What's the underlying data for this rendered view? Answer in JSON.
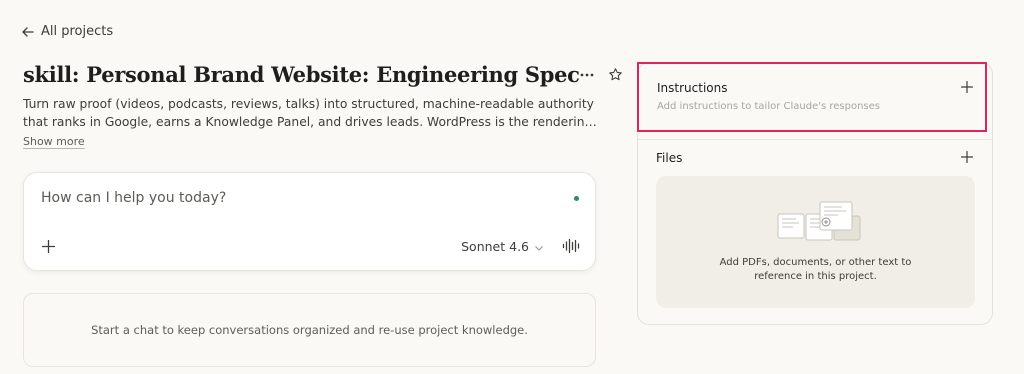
{
  "nav": {
    "back_label": "All projects"
  },
  "project": {
    "title": "skill: Personal Brand Website: Engineering Spec",
    "description": "Turn raw proof (videos, podcasts, reviews, talks) into structured, machine-readable authority that ranks in Google, earns a Knowledge Panel, and drives leads. WordPress is the rendering and editorial layer; th…",
    "show_more_label": "Show more"
  },
  "composer": {
    "placeholder": "How can I help you today?",
    "model": "Sonnet 4.6",
    "status_color": "#2a8a6c"
  },
  "chats": {
    "empty_text": "Start a chat to keep conversations organized and re-use project knowledge."
  },
  "instructions": {
    "title": "Instructions",
    "subtitle": "Add instructions to tailor Claude's responses",
    "highlight_color": "#e0245e"
  },
  "files": {
    "title": "Files",
    "empty_text_line1": "Add PDFs, documents, or other text to",
    "empty_text_line2": "reference in this project."
  },
  "icons": [
    "arrow-left-icon",
    "more-horizontal-icon",
    "star-icon",
    "plus-icon",
    "chevron-down-icon",
    "voice-waveform-icon",
    "documents-illustration"
  ]
}
